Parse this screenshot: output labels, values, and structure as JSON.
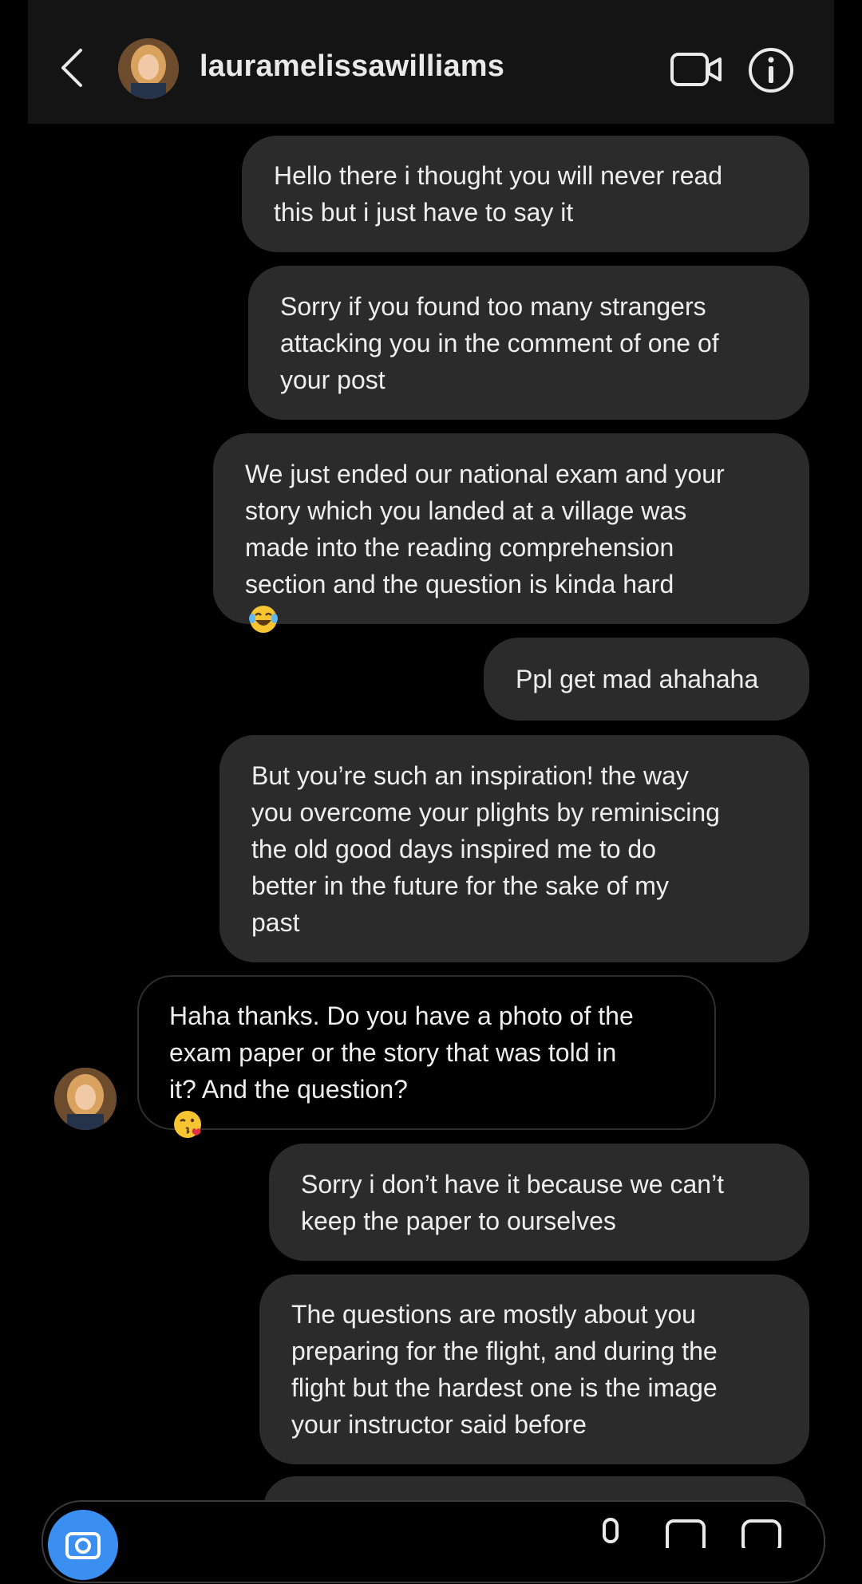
{
  "header": {
    "username": "lauramelissawilliams",
    "icons": {
      "back": "chevron-left-icon",
      "video": "video-call-icon",
      "info": "info-icon"
    }
  },
  "messages": [
    {
      "from": "me",
      "text": "Hello there i thought you will never read\nthis but i just have to say it"
    },
    {
      "from": "me",
      "text": "Sorry if you found too many strangers\nattacking you in the comment of one of\nyour post"
    },
    {
      "from": "me",
      "text": "We just ended our national exam and your\nstory which you landed at a village was\nmade into the reading comprehension\nsection and the question is kinda hard",
      "emoji": "laughing-tears-emoji"
    },
    {
      "from": "me",
      "text": "Ppl get mad ahahaha"
    },
    {
      "from": "me",
      "text": "But you’re such an inspiration! the way\nyou overcome your plights by reminiscing\nthe old good days inspired me to do\nbetter in the future for the sake of my\npast"
    },
    {
      "from": "them",
      "text": "Haha thanks. Do you have a photo of the\nexam paper or the story that was told in\nit? And the question?",
      "emoji": "kissing-heart-emoji"
    },
    {
      "from": "me",
      "text": "Sorry i don’t have it because we can’t\nkeep the paper to ourselves"
    },
    {
      "from": "me",
      "text": "The questions are mostly about you\npreparing for the flight, and during the\nflight but the hardest one is the image\nyour instructor said before"
    }
  ],
  "colors": {
    "background": "#000000",
    "header": "#141414",
    "sent_bubble": "#2b2b2b",
    "received_border": "#2e2e2e",
    "camera_button": "#3a8ff0"
  }
}
